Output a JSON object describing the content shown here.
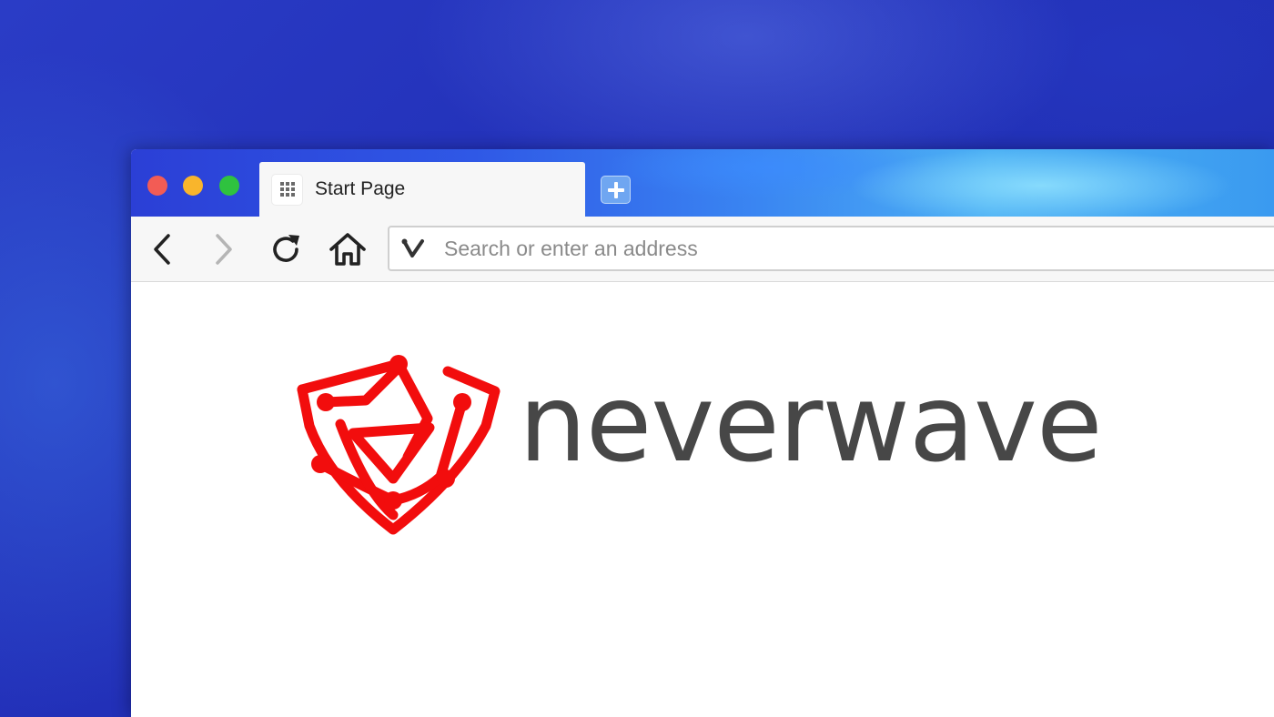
{
  "window": {
    "tab": {
      "title": "Start Page",
      "favicon": "grid-icon"
    },
    "new_tab_icon": "plus-icon"
  },
  "toolbar": {
    "back_icon": "chevron-left-icon",
    "forward_icon": "chevron-right-icon",
    "reload_icon": "reload-icon",
    "home_icon": "home-icon",
    "address": {
      "placeholder": "Search or enter an address",
      "value": "",
      "icon": "vivaldi-icon"
    }
  },
  "page": {
    "logo_icon": "neverwave-shield-icon",
    "brand_name": "neverwave"
  },
  "colors": {
    "brand_red": "#f20d0d",
    "wordmark_gray": "#474747",
    "tab_bg": "#f7f7f7",
    "close": "#f25c55",
    "minimize": "#f9b52c",
    "maximize": "#2fc23f"
  }
}
